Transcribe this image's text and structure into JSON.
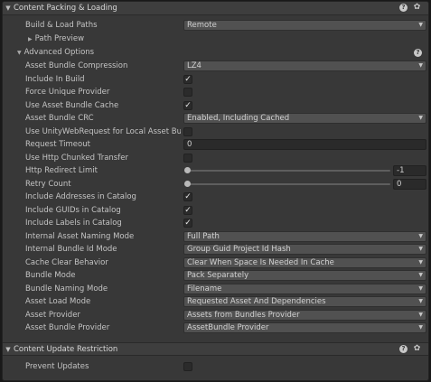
{
  "section1": {
    "title": "Content Packing & Loading",
    "build_load_paths": {
      "label": "Build & Load Paths",
      "value": "Remote"
    },
    "path_preview": "Path Preview",
    "advanced_options": "Advanced Options",
    "fields": [
      {
        "label": "Asset Bundle Compression",
        "type": "dropdown",
        "value": "LZ4"
      },
      {
        "label": "Include In Build",
        "type": "checkbox",
        "checked": true
      },
      {
        "label": "Force Unique Provider",
        "type": "checkbox",
        "checked": false
      },
      {
        "label": "Use Asset Bundle Cache",
        "type": "checkbox",
        "checked": true
      },
      {
        "label": "Asset Bundle CRC",
        "type": "dropdown",
        "value": "Enabled, Including Cached"
      },
      {
        "label": "Use UnityWebRequest for Local Asset Bun",
        "type": "checkbox",
        "checked": false
      },
      {
        "label": "Request Timeout",
        "type": "text",
        "value": "0"
      },
      {
        "label": "Use Http Chunked Transfer",
        "type": "checkbox",
        "checked": false
      },
      {
        "label": "Http Redirect Limit",
        "type": "slider",
        "value": "-1",
        "fraction": 0.0
      },
      {
        "label": "Retry Count",
        "type": "slider",
        "value": "0",
        "fraction": 0.0
      },
      {
        "label": "Include Addresses in Catalog",
        "type": "checkbox",
        "checked": true
      },
      {
        "label": "Include GUIDs in Catalog",
        "type": "checkbox",
        "checked": true
      },
      {
        "label": "Include Labels in Catalog",
        "type": "checkbox",
        "checked": true
      },
      {
        "label": "Internal Asset Naming Mode",
        "type": "dropdown",
        "value": "Full Path"
      },
      {
        "label": "Internal Bundle Id Mode",
        "type": "dropdown",
        "value": "Group Guid Project Id Hash"
      },
      {
        "label": "Cache Clear Behavior",
        "type": "dropdown",
        "value": "Clear When Space Is Needed In Cache"
      },
      {
        "label": "Bundle Mode",
        "type": "dropdown",
        "value": "Pack Separately"
      },
      {
        "label": "Bundle Naming Mode",
        "type": "dropdown",
        "value": "Filename"
      },
      {
        "label": "Asset Load Mode",
        "type": "dropdown",
        "value": "Requested Asset And Dependencies"
      },
      {
        "label": "Asset Provider",
        "type": "dropdown",
        "value": "Assets from Bundles Provider"
      },
      {
        "label": "Asset Bundle Provider",
        "type": "dropdown",
        "value": "AssetBundle Provider"
      }
    ]
  },
  "section2": {
    "title": "Content Update Restriction",
    "prevent_updates": {
      "label": "Prevent Updates",
      "checked": false
    }
  },
  "icons": {
    "foldout_open": "triangle-down-icon",
    "foldout_closed": "triangle-right-icon",
    "help": "help-icon",
    "settings": "gear-icon"
  },
  "glyphs": {
    "check": "✓",
    "help": "?",
    "gear": "✿",
    "tri_down": "▼",
    "tri_right": "▶"
  }
}
